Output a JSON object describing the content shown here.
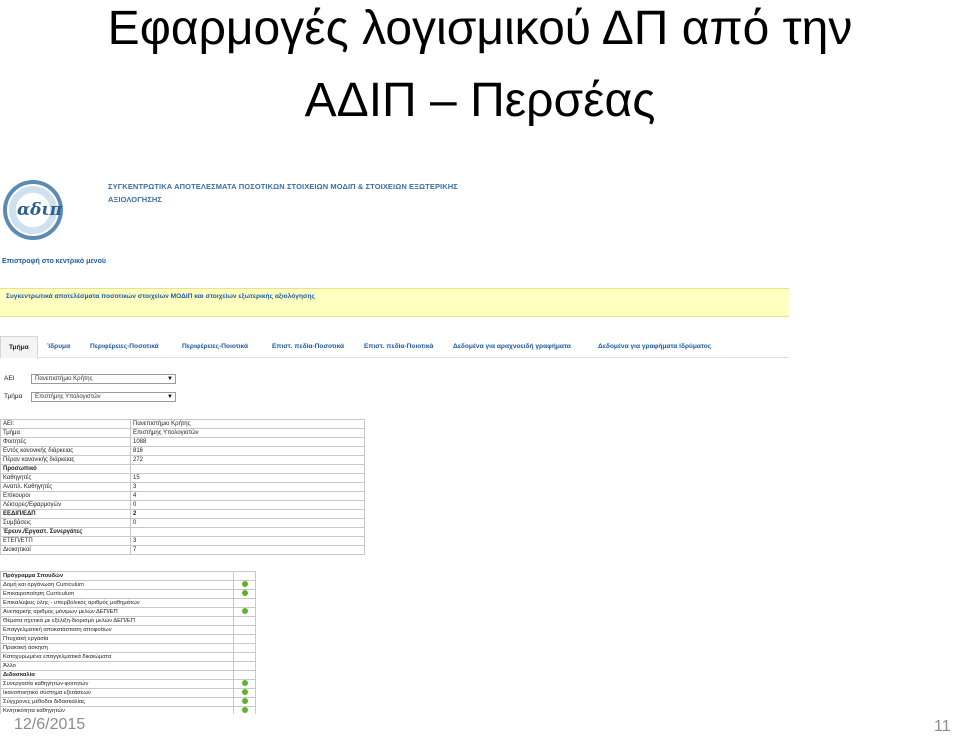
{
  "slide": {
    "title_line1": "Εφαρμογές λογισμικού ΔΠ από την",
    "title_line2": "ΑΔΙΠ – Περσέας",
    "date": "12/6/2015",
    "page_number": "11"
  },
  "app": {
    "logo_text": "αδιπ",
    "header_title": "ΣΥΓΚΕΝΤΡΩΤΙΚΑ ΑΠΟΤΕΛΕΣΜΑΤΑ ΠΟΣΟΤΙΚΩΝ ΣΤΟΙΧΕΙΩΝ ΜΟΔΙΠ & ΣΤΟΙΧΕΙΩΝ ΕΞΩΤΕΡΙΚΗΣ ΑΞΙΟΛΟΓΗΣΗΣ",
    "return_link": "Επιστροφή στο κεντρικό μενού",
    "banner": "Συγκεντρωτικά αποτελέσματα ποσοτικών στοιχείων ΜΟΔΙΠ και στοιχείων εξωτερικής αξιολόγησης",
    "tabs": [
      "Τμήμα",
      "Ίδρυμα",
      "Περιφέρειες-Ποσοτικά",
      "Περιφέρειες-Ποιοτικά",
      "Επιστ. πεδία-Ποσοτικά",
      "Επιστ. πεδία-Ποιοτικά",
      "Δεδομένα για αραχνοειδή γραφήματα",
      "Δεδομένα για γραφήματα Ιδρύματος"
    ],
    "form": {
      "aei_label": "ΑΕΙ",
      "aei_value": "Πανεπιστήμιο Κρήτης",
      "tmima_label": "Τμήμα",
      "tmima_value": "Επιστήμης Υπολογιστών"
    },
    "stats_rows": [
      {
        "k": "ΑΕΙ:",
        "v": "Πανεπιστήμιο Κρήτης"
      },
      {
        "k": "Τμήμα",
        "v": "Επιστήμης Υπολογιστών"
      },
      {
        "k": "Φοιτητές",
        "v": "1088"
      },
      {
        "k": "Εντός κανονικής διάρκειας",
        "v": "816"
      },
      {
        "k": "Πέραν κανονικής διάρκειας",
        "v": "272"
      },
      {
        "k": "Προσωπικό",
        "v": "",
        "section": true
      },
      {
        "k": "Καθηγητές",
        "v": "15"
      },
      {
        "k": "Αναπλ. Καθηγητές",
        "v": "3"
      },
      {
        "k": "Επίκουροι",
        "v": "4"
      },
      {
        "k": "Λέκτορες/Εφαρμογών",
        "v": "0"
      },
      {
        "k": "ΕΕΔΙΠ/ΕΔΠ",
        "v": "2",
        "section": true
      },
      {
        "k": "Συμβάσεις",
        "v": "0"
      },
      {
        "k": "Έρευν./Εργαστ. Συνεργάτες",
        "v": "",
        "section": true
      },
      {
        "k": "ΕΤΕΠ/ΕΤΠ",
        "v": "3"
      },
      {
        "k": "Διοικητικοί",
        "v": "7"
      }
    ],
    "program_rows": [
      {
        "k": "Πρόγραμμα Σπουδών",
        "dot": false,
        "section": true
      },
      {
        "k": "Δομή και οργάνωση Curriculum",
        "dot": true
      },
      {
        "k": "Επικαιροποίηση Curriculum",
        "dot": true
      },
      {
        "k": "Επικαλύψεις ύλης - υπερβολικός αριθμός μαθημάτων",
        "dot": false
      },
      {
        "k": "Ανεπαρκής αριθμός μόνιμων μελών ΔΕΠ/ΕΠ",
        "dot": true
      },
      {
        "k": "Θέματα σχετικά με εξέλιξη-διορισμό μελών ΔΕΠ/ΕΠ",
        "dot": false
      },
      {
        "k": "Επαγγελματική αποκατάσταση αποφοίτων",
        "dot": false
      },
      {
        "k": "Πτυχιακή εργασία",
        "dot": false
      },
      {
        "k": "Πρακτική άσκηση",
        "dot": false
      },
      {
        "k": "Κατοχυρωμένα επαγγελματικά δικαιώματα",
        "dot": false
      },
      {
        "k": "Άλλο",
        "dot": false
      },
      {
        "k": "Διδασκαλία",
        "dot": false,
        "section": true
      },
      {
        "k": "Συνεργασία καθηγητών-φοιτητών",
        "dot": true
      },
      {
        "k": "Ικανοποιητικό σύστημα εξετάσεων",
        "dot": true
      },
      {
        "k": "Σύγχρονες μέθοδοι διδασκαλίας",
        "dot": true
      },
      {
        "k": "Κινητικότητα καθηγητών",
        "dot": true
      }
    ],
    "colors": {
      "link_blue": "#1d5aa0",
      "banner_yellow": "#ffffbf",
      "status_green": "#62b02f"
    }
  }
}
